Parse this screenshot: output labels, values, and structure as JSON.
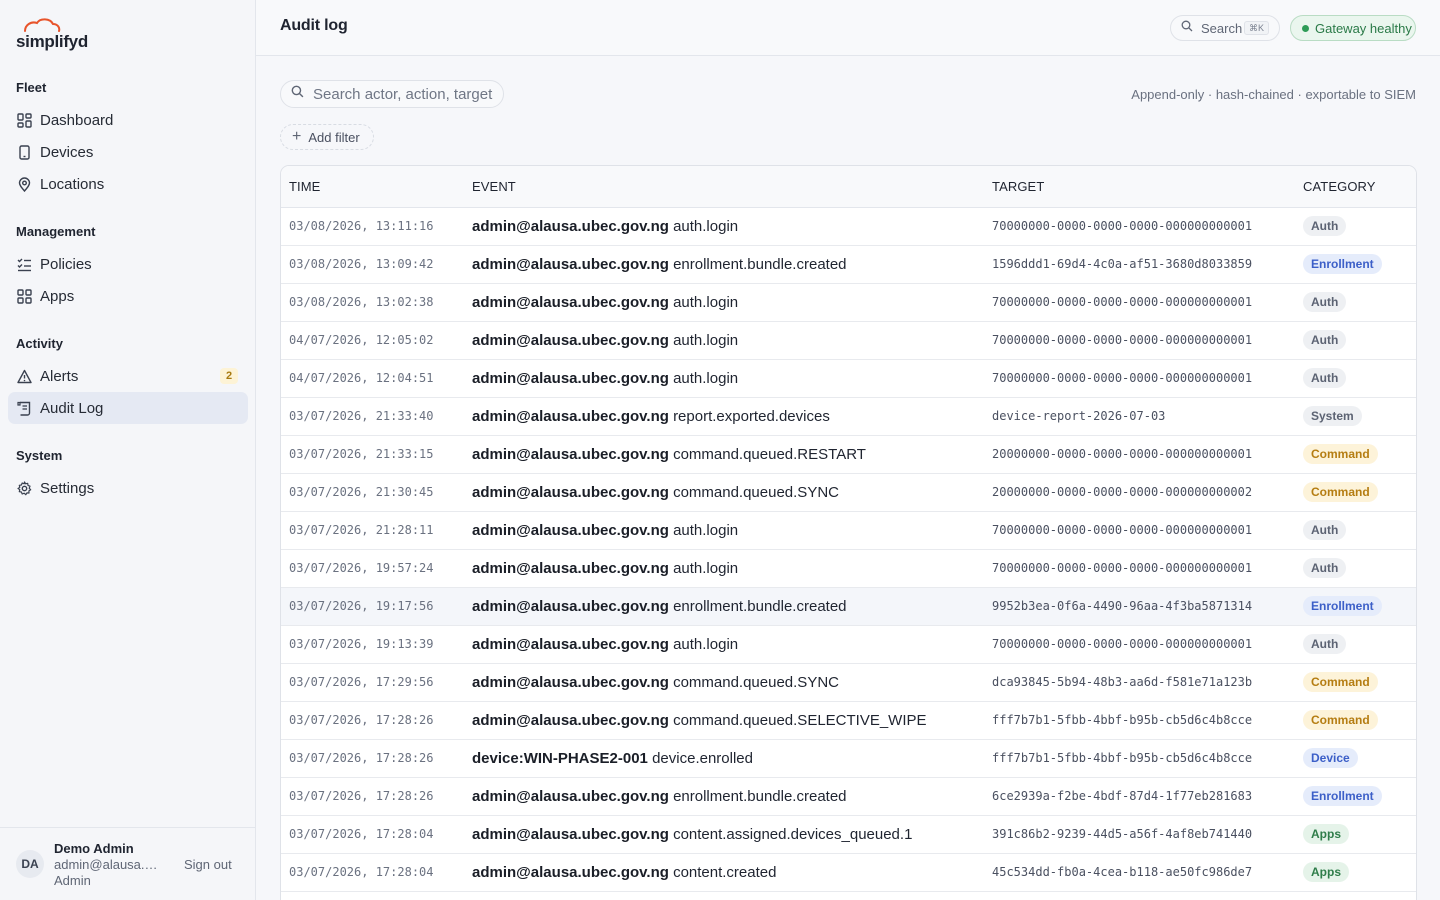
{
  "brand": {
    "name": "simplifyd"
  },
  "sidebar": {
    "sections": [
      {
        "heading": "Fleet",
        "items": [
          {
            "label": "Dashboard",
            "icon": "dashboard-icon"
          },
          {
            "label": "Devices",
            "icon": "device-icon"
          },
          {
            "label": "Locations",
            "icon": "location-pin-icon"
          }
        ]
      },
      {
        "heading": "Management",
        "items": [
          {
            "label": "Policies",
            "icon": "policy-list-icon"
          },
          {
            "label": "Apps",
            "icon": "apps-grid-icon"
          }
        ]
      },
      {
        "heading": "Activity",
        "items": [
          {
            "label": "Alerts",
            "icon": "warning-triangle-icon",
            "badge": "2"
          },
          {
            "label": "Audit Log",
            "icon": "scroll-icon",
            "active": true
          }
        ]
      },
      {
        "heading": "System",
        "items": [
          {
            "label": "Settings",
            "icon": "gear-icon"
          }
        ]
      }
    ]
  },
  "user": {
    "initials": "DA",
    "name": "Demo Admin",
    "email": "admin@alausa.ubec.gov.ng",
    "role": "Admin",
    "signout_label": "Sign out"
  },
  "header": {
    "title": "Audit log",
    "search_label": "Search",
    "search_shortcut": "⌘K",
    "status": "Gateway healthy",
    "status_color": "#2e9c57"
  },
  "filters": {
    "search_placeholder": "Search actor, action, target...",
    "add_filter_label": "Add filter",
    "note": "Append-only · hash-chained · exportable to SIEM"
  },
  "table": {
    "columns": [
      "TIME",
      "EVENT",
      "TARGET",
      "CATEGORY"
    ],
    "rows": [
      {
        "time": "03/08/2026, 13:11:16",
        "actor": "admin@alausa.ubec.gov.ng",
        "action": "auth.login",
        "target": "70000000-0000-0000-0000-000000000001",
        "category": "Auth",
        "kind": "auth"
      },
      {
        "time": "03/08/2026, 13:09:42",
        "actor": "admin@alausa.ubec.gov.ng",
        "action": "enrollment.bundle.created",
        "target": "1596ddd1-69d4-4c0a-af51-3680d8033859",
        "category": "Enrollment",
        "kind": "enroll"
      },
      {
        "time": "03/08/2026, 13:02:38",
        "actor": "admin@alausa.ubec.gov.ng",
        "action": "auth.login",
        "target": "70000000-0000-0000-0000-000000000001",
        "category": "Auth",
        "kind": "auth"
      },
      {
        "time": "04/07/2026, 12:05:02",
        "actor": "admin@alausa.ubec.gov.ng",
        "action": "auth.login",
        "target": "70000000-0000-0000-0000-000000000001",
        "category": "Auth",
        "kind": "auth"
      },
      {
        "time": "04/07/2026, 12:04:51",
        "actor": "admin@alausa.ubec.gov.ng",
        "action": "auth.login",
        "target": "70000000-0000-0000-0000-000000000001",
        "category": "Auth",
        "kind": "auth"
      },
      {
        "time": "03/07/2026, 21:33:40",
        "actor": "admin@alausa.ubec.gov.ng",
        "action": "report.exported.devices",
        "target": "device-report-2026-07-03",
        "category": "System",
        "kind": "system"
      },
      {
        "time": "03/07/2026, 21:33:15",
        "actor": "admin@alausa.ubec.gov.ng",
        "action": "command.queued.RESTART",
        "target": "20000000-0000-0000-0000-000000000001",
        "category": "Command",
        "kind": "command"
      },
      {
        "time": "03/07/2026, 21:30:45",
        "actor": "admin@alausa.ubec.gov.ng",
        "action": "command.queued.SYNC",
        "target": "20000000-0000-0000-0000-000000000002",
        "category": "Command",
        "kind": "command"
      },
      {
        "time": "03/07/2026, 21:28:11",
        "actor": "admin@alausa.ubec.gov.ng",
        "action": "auth.login",
        "target": "70000000-0000-0000-0000-000000000001",
        "category": "Auth",
        "kind": "auth"
      },
      {
        "time": "03/07/2026, 19:57:24",
        "actor": "admin@alausa.ubec.gov.ng",
        "action": "auth.login",
        "target": "70000000-0000-0000-0000-000000000001",
        "category": "Auth",
        "kind": "auth"
      },
      {
        "time": "03/07/2026, 19:17:56",
        "actor": "admin@alausa.ubec.gov.ng",
        "action": "enrollment.bundle.created",
        "target": "9952b3ea-0f6a-4490-96aa-4f3ba5871314",
        "category": "Enrollment",
        "kind": "enroll",
        "highlight": true
      },
      {
        "time": "03/07/2026, 19:13:39",
        "actor": "admin@alausa.ubec.gov.ng",
        "action": "auth.login",
        "target": "70000000-0000-0000-0000-000000000001",
        "category": "Auth",
        "kind": "auth"
      },
      {
        "time": "03/07/2026, 17:29:56",
        "actor": "admin@alausa.ubec.gov.ng",
        "action": "command.queued.SYNC",
        "target": "dca93845-5b94-48b3-aa6d-f581e71a123b",
        "category": "Command",
        "kind": "command"
      },
      {
        "time": "03/07/2026, 17:28:26",
        "actor": "admin@alausa.ubec.gov.ng",
        "action": "command.queued.SELECTIVE_WIPE",
        "target": "fff7b7b1-5fbb-4bbf-b95b-cb5d6c4b8cce",
        "category": "Command",
        "kind": "command"
      },
      {
        "time": "03/07/2026, 17:28:26",
        "actor": "device:WIN-PHASE2-001",
        "action": "device.enrolled",
        "target": "fff7b7b1-5fbb-4bbf-b95b-cb5d6c4b8cce",
        "category": "Device",
        "kind": "device"
      },
      {
        "time": "03/07/2026, 17:28:26",
        "actor": "admin@alausa.ubec.gov.ng",
        "action": "enrollment.bundle.created",
        "target": "6ce2939a-f2be-4bdf-87d4-1f77eb281683",
        "category": "Enrollment",
        "kind": "enroll"
      },
      {
        "time": "03/07/2026, 17:28:04",
        "actor": "admin@alausa.ubec.gov.ng",
        "action": "content.assigned.devices_queued.1",
        "target": "391c86b2-9239-44d5-a56f-4af8eb741440",
        "category": "Apps",
        "kind": "apps"
      },
      {
        "time": "03/07/2026, 17:28:04",
        "actor": "admin@alausa.ubec.gov.ng",
        "action": "content.created",
        "target": "45c534dd-fb0a-4cea-b118-ae50fc986de7",
        "category": "Apps",
        "kind": "apps"
      },
      {
        "time": "",
        "actor": "",
        "action": "",
        "target": "",
        "category": "",
        "kind": ""
      }
    ]
  }
}
